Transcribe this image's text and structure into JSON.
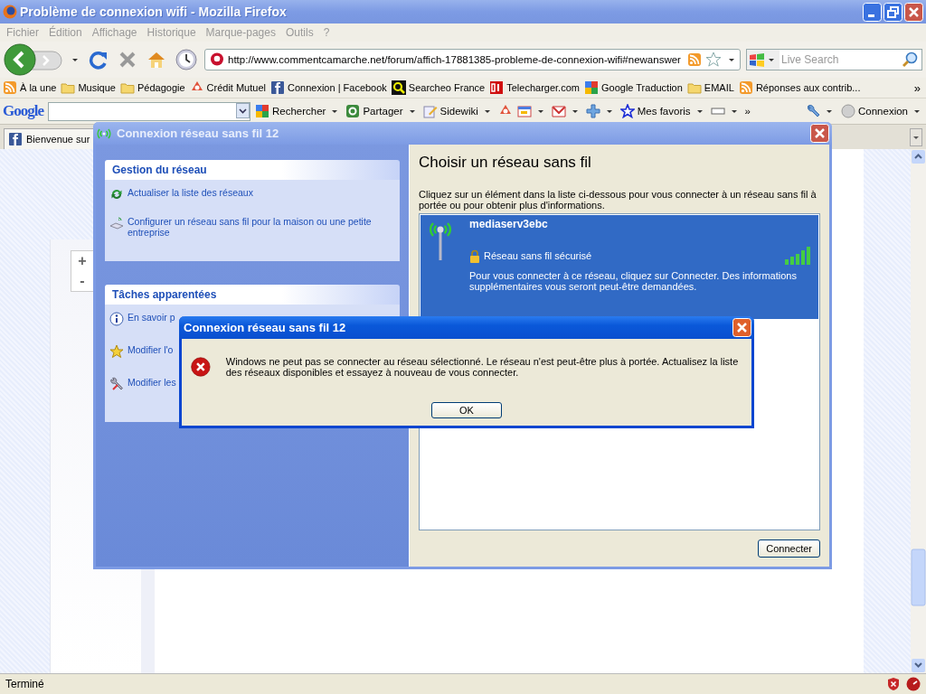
{
  "browser": {
    "title": "Problème de connexion wifi - Mozilla Firefox",
    "menu": [
      "Fichier",
      "Édition",
      "Affichage",
      "Historique",
      "Marque-pages",
      "Outils",
      "?"
    ],
    "address": "http://www.commentcamarche.net/forum/affich-17881385-probleme-de-connexion-wifi#newanswer",
    "search_placeholder": "Live Search",
    "bookmarks": [
      {
        "kind": "feed",
        "label": "À la une"
      },
      {
        "kind": "folder",
        "label": "Musique"
      },
      {
        "kind": "folder",
        "label": "Pédagogie"
      },
      {
        "kind": "bank",
        "label": "Crédit Mutuel"
      },
      {
        "kind": "facebook",
        "label": "Connexion | Facebook"
      },
      {
        "kind": "magnifier",
        "label": "Searcheo France"
      },
      {
        "kind": "tile",
        "label": "Telecharger.com"
      },
      {
        "kind": "google",
        "label": "Google Traduction"
      },
      {
        "kind": "folder",
        "label": "EMAIL"
      },
      {
        "kind": "feed",
        "label": "Réponses aux contrib..."
      }
    ],
    "bookmarks_more": "»",
    "google_logo": "Google",
    "toolbar": [
      {
        "kind": "google",
        "label": "Rechercher",
        "caret": true
      },
      {
        "kind": "share",
        "label": "Partager",
        "caret": true
      },
      {
        "kind": "pencil",
        "label": "Sidewiki",
        "caret": true
      },
      {
        "kind": "bank",
        "caret": false
      },
      {
        "kind": "calendar",
        "caret": true
      },
      {
        "kind": "mail",
        "caret": true
      },
      {
        "kind": "plus",
        "caret": true
      },
      {
        "kind": "star",
        "label": "Mes favoris",
        "caret": true
      },
      {
        "kind": "blank",
        "caret": true
      },
      {
        "kind": "text",
        "label": "»",
        "caret": false
      }
    ],
    "toolbar_right": [
      {
        "kind": "wrench",
        "caret": true
      },
      {
        "kind": "circle",
        "label": "Connexion",
        "caret": true
      }
    ],
    "tabs": [
      {
        "label": "Bienvenue sur",
        "selected": true
      }
    ],
    "status": "Terminé"
  },
  "page": {
    "zoom_buttons": [
      "+",
      "-"
    ]
  },
  "wireless_window": {
    "title": "Connexion réseau sans fil 12",
    "sections": [
      {
        "title": "Gestion du réseau",
        "tasks": [
          {
            "kind": "refresh",
            "label": "Actualiser la liste des réseaux"
          },
          {
            "kind": "setup",
            "label": "Configurer un réseau sans fil pour la maison ou une petite entreprise"
          }
        ]
      },
      {
        "title": "Tâches apparentées",
        "tasks": [
          {
            "kind": "info",
            "label": "En savoir p"
          },
          {
            "kind": "star",
            "label": "Modifier l'o"
          },
          {
            "kind": "tools",
            "label": "Modifier les"
          }
        ]
      }
    ],
    "heading": "Choisir un réseau sans fil",
    "intro": "Cliquez sur un élément dans la liste ci-dessous pour vous connecter à un réseau sans fil à portée ou pour obtenir plus d'informations.",
    "networks": [
      {
        "name": "mediaserv3ebc",
        "security": "Réseau sans fil sécurisé",
        "description": "Pour vous connecter à ce réseau, cliquez sur Connecter. Des informations supplémentaires vous seront peut-être demandées.",
        "selected": true
      }
    ],
    "button": "Connecter"
  },
  "error_dialog": {
    "title": "Connexion réseau sans fil 12",
    "message": "Windows ne peut pas se connecter au réseau sélectionné. Le réseau n'est peut-être plus à portée. Actualisez la liste des réseaux disponibles et essayez à nouveau de vous connecter.",
    "button": "OK"
  }
}
